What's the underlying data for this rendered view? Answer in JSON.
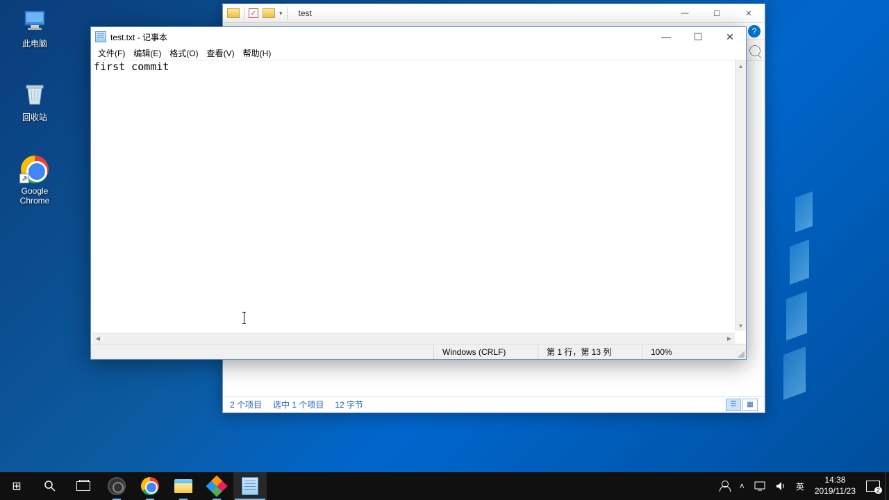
{
  "desktop": {
    "icons": {
      "this_pc": "此电脑",
      "recycle_bin": "回收站",
      "chrome": "Google Chrome"
    }
  },
  "explorer": {
    "title": "test",
    "status": {
      "items": "2 个项目",
      "selected": "选中 1 个项目",
      "size": "12 字节"
    }
  },
  "notepad": {
    "title": "test.txt - 记事本",
    "menu": {
      "file": "文件(F)",
      "edit": "编辑(E)",
      "format": "格式(O)",
      "view": "查看(V)",
      "help": "帮助(H)"
    },
    "content": "first commit",
    "status": {
      "encoding": "Windows (CRLF)",
      "position": "第 1 行，第 13 列",
      "zoom": "100%"
    }
  },
  "taskbar": {
    "ime": "英",
    "time": "14:38",
    "date": "2019/11/23",
    "notif_count": "2"
  }
}
